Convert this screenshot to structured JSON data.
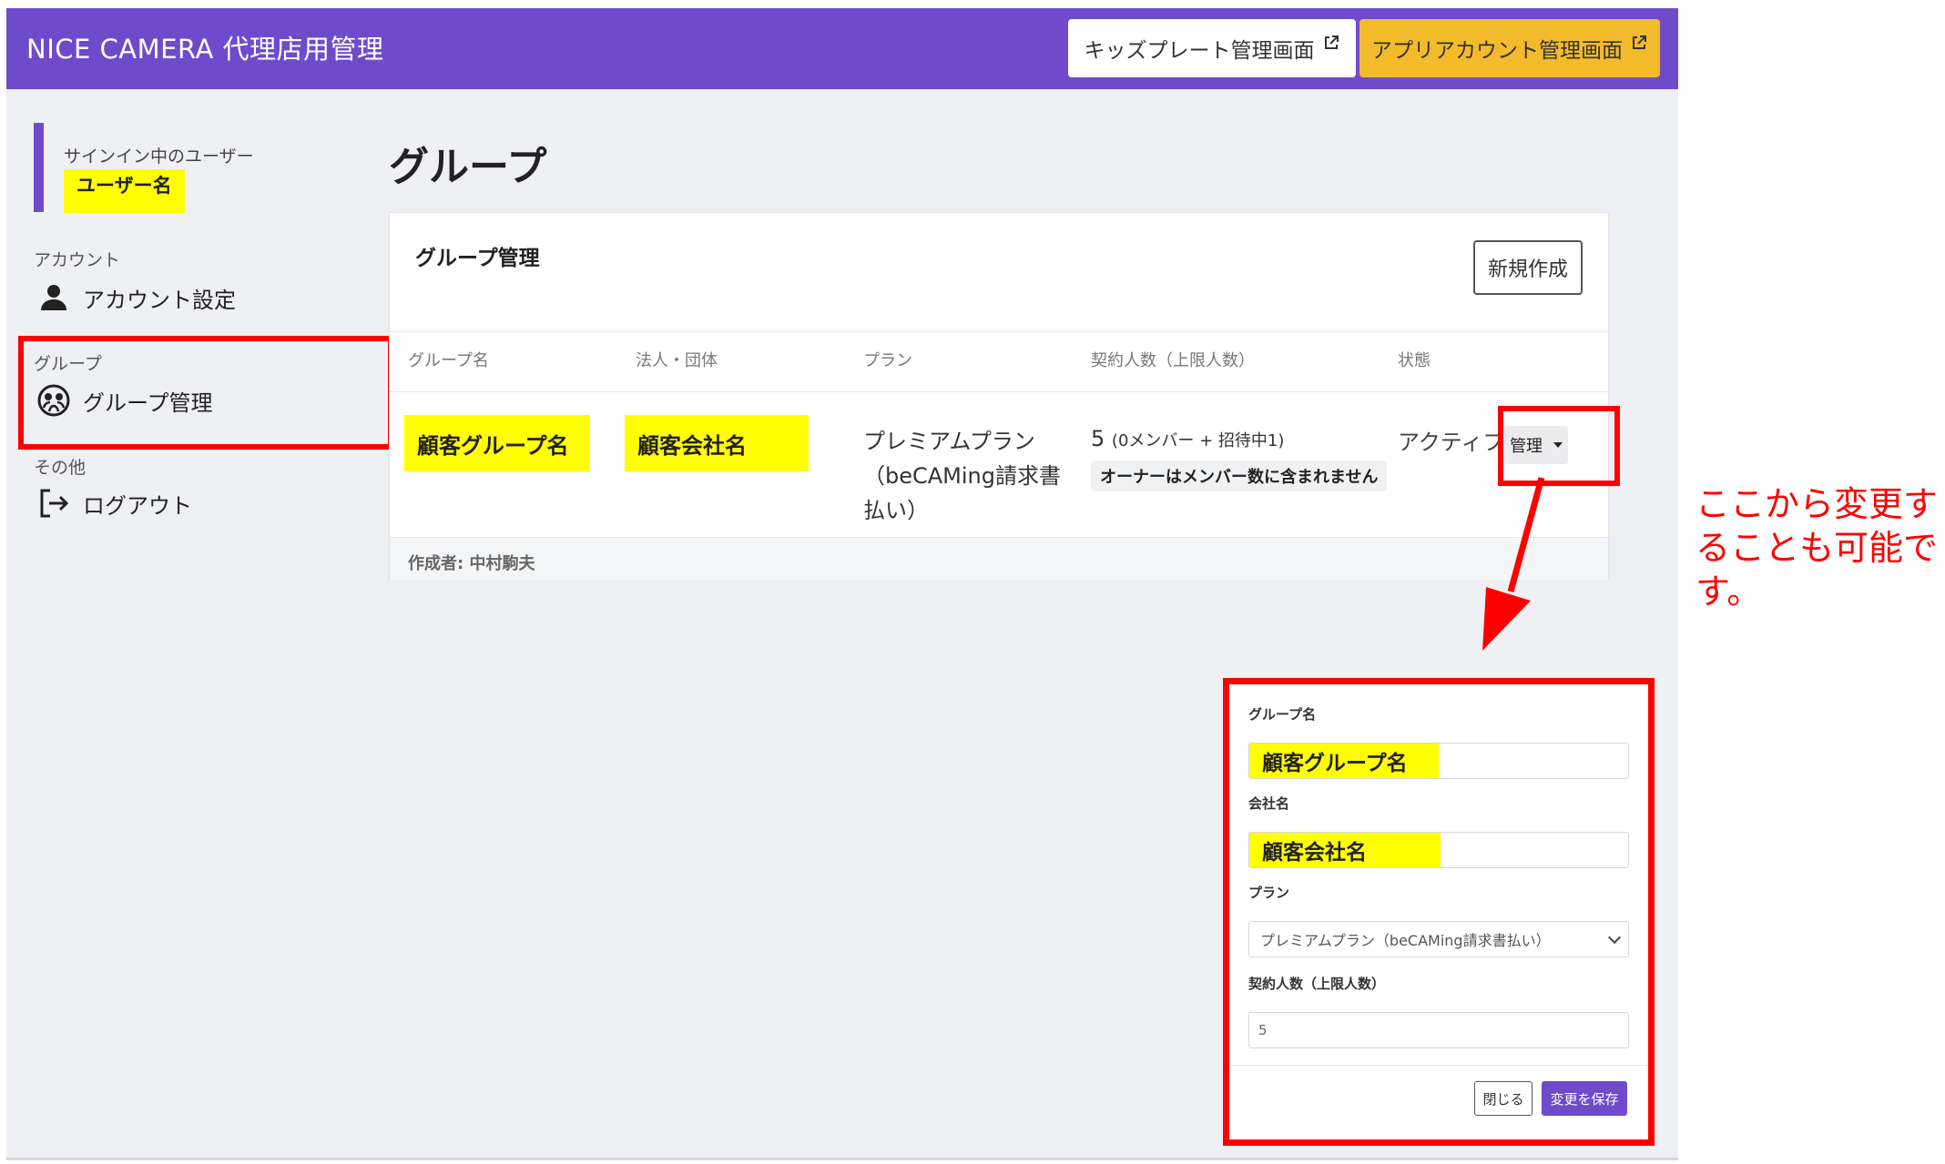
{
  "header": {
    "brand": "NICE CAMERA 代理店用管理",
    "kids_button": "キッズプレート管理画面",
    "app_account_button": "アプリアカウント管理画面"
  },
  "sidebar": {
    "signed_in_caption": "サインイン中のユーザー",
    "user_name": "ユーザー名",
    "sections": [
      {
        "title": "アカウント",
        "item": "アカウント設定",
        "icon": "person-icon"
      },
      {
        "title": "グループ",
        "item": "グループ管理",
        "icon": "group-icon"
      },
      {
        "title": "その他",
        "item": "ログアウト",
        "icon": "logout-icon"
      }
    ]
  },
  "page": {
    "title": "グループ"
  },
  "card": {
    "title": "グループ管理",
    "new_button": "新規作成",
    "columns": [
      "グループ名",
      "法人・団体",
      "プラン",
      "契約人数（上限人数）",
      "状態"
    ],
    "row": {
      "group_name": "顧客グループ名",
      "company": "顧客会社名",
      "plan_lines": [
        "プレミアムプラン",
        "（beCAMing請求書",
        "払い）"
      ],
      "count_main": "5",
      "count_sub": "(0メンバー + 招待中1)",
      "count_note": "オーナーはメンバー数に含まれません",
      "status": "アクティブ",
      "manage_button": "管理"
    },
    "footer": "作成者: 中村駒夫"
  },
  "annotation": "ここから変更することも可能です。",
  "modal": {
    "group_label": "グループ名",
    "group_value": "顧客グループ名",
    "company_label": "会社名",
    "company_value": "顧客会社名",
    "plan_label": "プラン",
    "plan_value": "プレミアムプラン（beCAMing請求書払い）",
    "count_label": "契約人数（上限人数）",
    "count_value": "5",
    "close_button": "閉じる",
    "save_button": "変更を保存"
  },
  "colors": {
    "brand": "#6f4bcb",
    "accent": "#f3bb2b",
    "highlight": "#ffff00",
    "annotation": "#ff0000"
  }
}
